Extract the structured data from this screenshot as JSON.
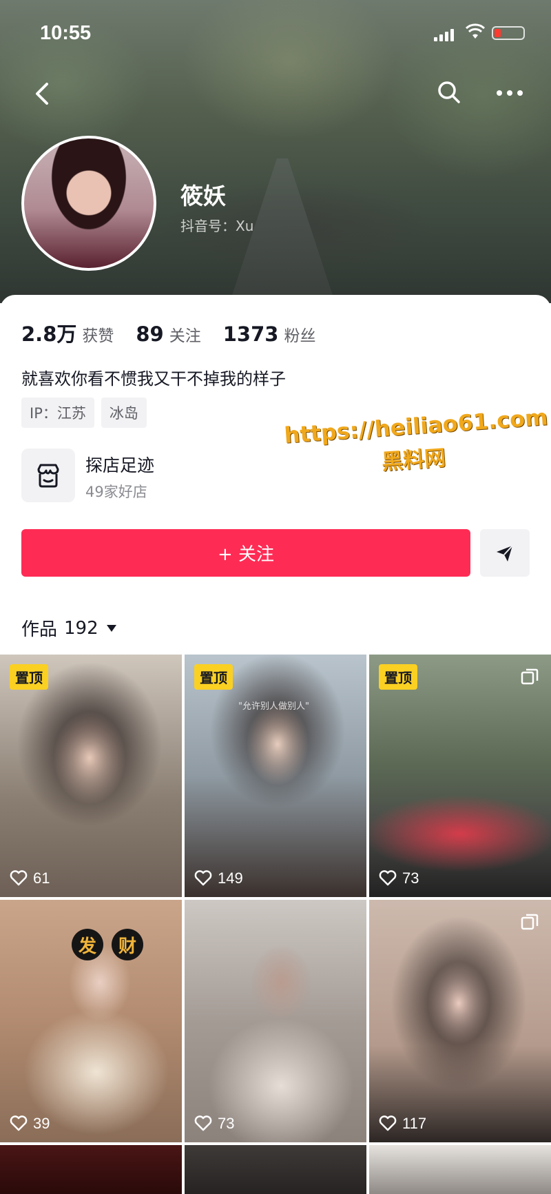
{
  "status_bar": {
    "time": "10:55"
  },
  "profile": {
    "name": "筱妖",
    "douyin_id": "抖音号：Xu",
    "stats": [
      {
        "num": "2.8万",
        "label": "获赞"
      },
      {
        "num": "89",
        "label": "关注"
      },
      {
        "num": "1373",
        "label": "粉丝"
      }
    ],
    "bio": "就喜欢你看不惯我又干不掉我的样子",
    "tags": [
      "IP：江苏",
      "冰岛"
    ],
    "shop": {
      "title": "探店足迹",
      "subtitle": "49家好店"
    }
  },
  "watermark": {
    "line1": "https://heiliao61.com",
    "line2": "黑料网"
  },
  "actions": {
    "follow_label": "+ 关注"
  },
  "works": {
    "label": "作品",
    "count": "192"
  },
  "tiles": [
    {
      "pinned": "置顶",
      "likes": "61"
    },
    {
      "pinned": "置顶",
      "likes": "149",
      "caption": "\"允许别人做别人\""
    },
    {
      "pinned": "置顶",
      "likes": "73"
    },
    {
      "likes": "39",
      "overlay": [
        "发",
        "财"
      ]
    },
    {
      "likes": "73"
    },
    {
      "likes": "117"
    }
  ],
  "colors": {
    "accent": "#fe2c55",
    "pin": "#fad022"
  }
}
